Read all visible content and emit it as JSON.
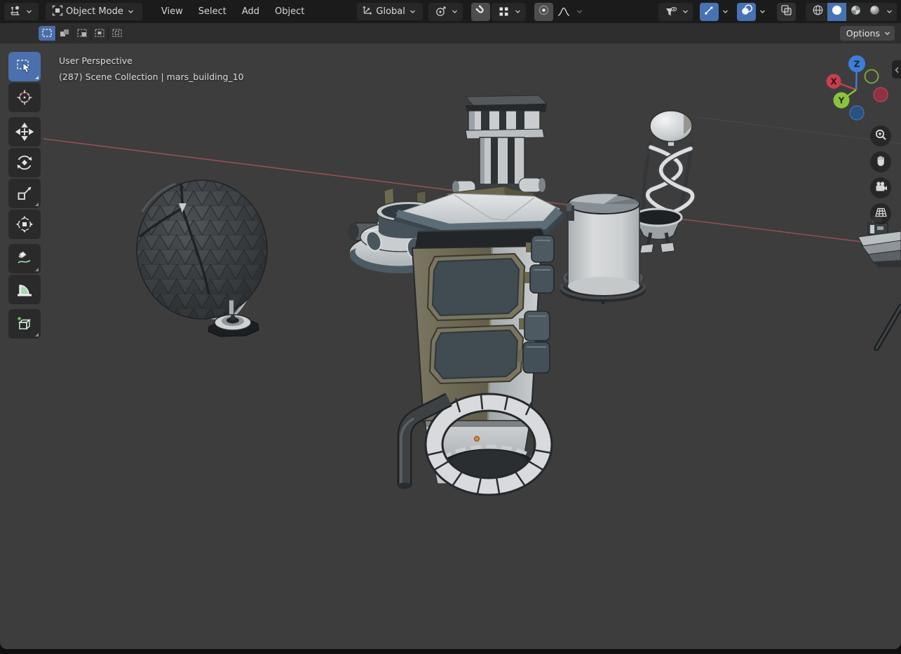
{
  "header": {
    "editor_type_icon": "3d-viewport-editor-icon",
    "mode_icon": "object-mode-icon",
    "mode_label": "Object Mode",
    "menus": [
      "View",
      "Select",
      "Add",
      "Object"
    ],
    "orientation_icon": "transform-orientation-axes-icon",
    "orientation_label": "Global",
    "pivot_icon": "pivot-point-icon",
    "snap_icon": "magnet-icon",
    "snap_target_icon": "snap-target-icon",
    "proportional_icon": "proportional-editing-icon",
    "falloff_icon": "falloff-curve-icon",
    "visibility_icon": "show-object-types-icon",
    "gizmo_icon": "viewport-gizmos-icon",
    "overlays_icon": "viewport-overlays-icon",
    "xray_icon": "toggle-xray-icon",
    "shading_icons": [
      "wireframe-shading-icon",
      "solid-shading-icon",
      "material-preview-shading-icon",
      "rendered-shading-icon"
    ]
  },
  "tool_settings": {
    "select_mode_icons": [
      "select-set-icon",
      "select-extend-icon",
      "select-subtract-icon",
      "select-invert-icon",
      "select-intersect-icon"
    ],
    "options_label": "Options"
  },
  "toolbar": {
    "tools": [
      "select-box",
      "cursor",
      "move",
      "rotate",
      "scale",
      "transform",
      "annotate",
      "measure",
      "add-cube"
    ],
    "active_tool": "select-box"
  },
  "viewport": {
    "perspective_label": "User Perspective",
    "collection_label": "(287) Scene Collection | mars_building_10"
  },
  "nav_gizmo": {
    "x_label": "X",
    "y_label": "Y",
    "z_label": "Z"
  },
  "colors": {
    "header_bg": "#1b1b1b",
    "toolrow_bg": "#2e2e2e",
    "viewport_bg": "#3d3d3d",
    "accent_blue": "#4772b3",
    "axis_x": "#c4404f",
    "axis_y": "#8ac43e",
    "axis_z": "#3d7fd6",
    "x_axis_grid_line": "#9e5358",
    "origin_dot_orange": "#e8872a"
  }
}
